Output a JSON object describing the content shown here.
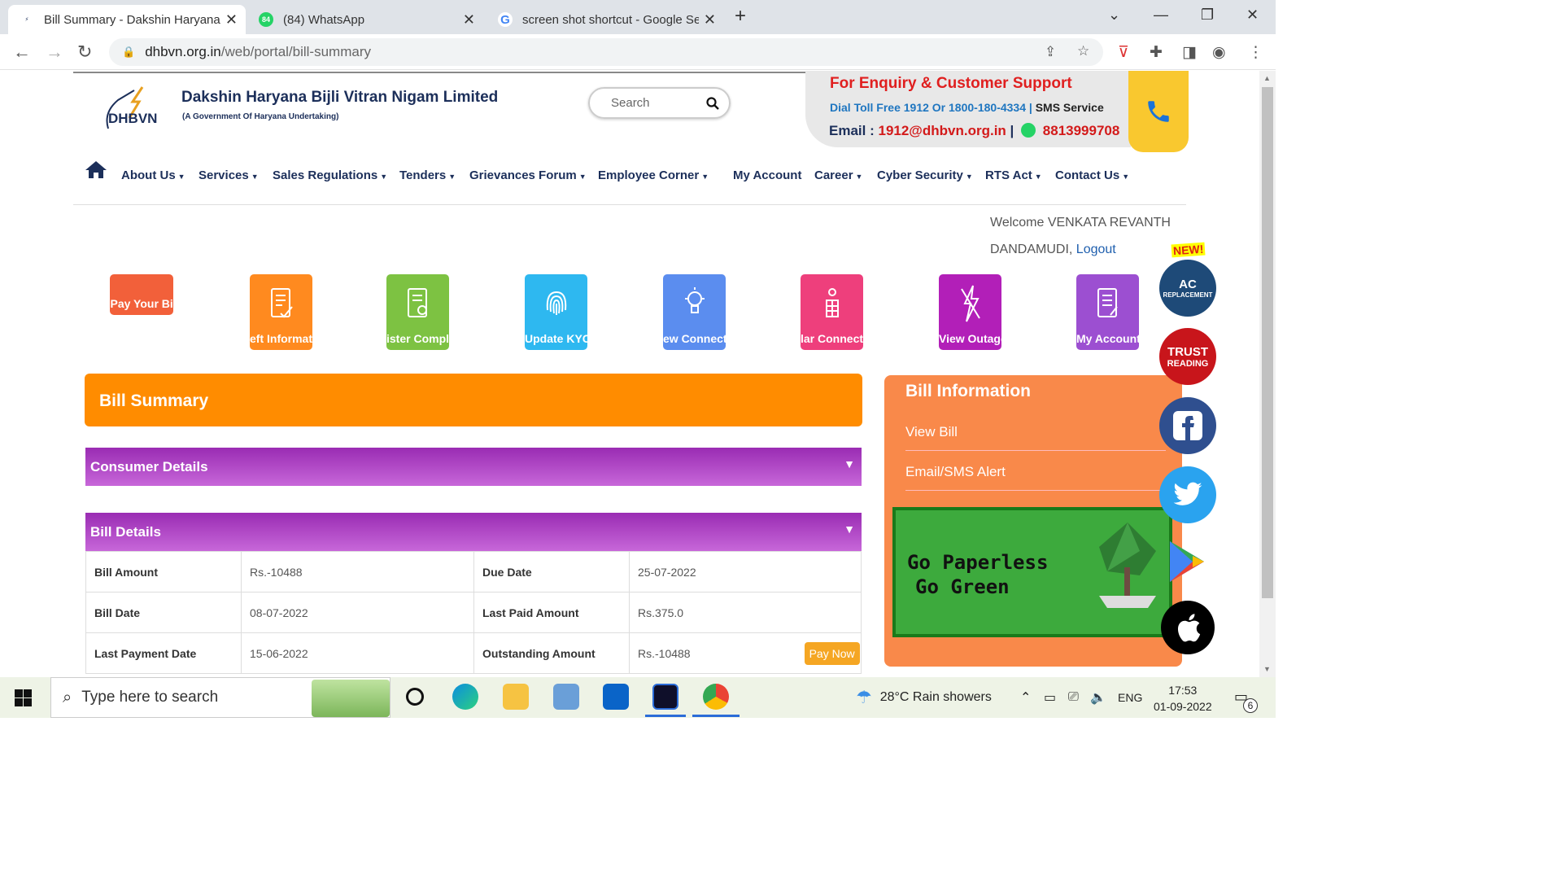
{
  "browser": {
    "tabs": [
      {
        "title": "Bill Summary - Dakshin Haryana B",
        "favicon": "dhbvn-favicon"
      },
      {
        "title": "(84) WhatsApp",
        "favicon": "whatsapp-favicon",
        "badge": "84"
      },
      {
        "title": "screen shot shortcut - Google Se",
        "favicon": "google-favicon"
      }
    ],
    "url_domain": "dhbvn.org.in",
    "url_path": "/web/portal/bill-summary"
  },
  "header": {
    "logo_text": "DHBVN",
    "org_name": "Dakshin Haryana Bijli Vitran Nigam Limited",
    "org_sub": "(A Government Of Haryana Undertaking)",
    "search_placeholder": "Search",
    "support_title": "For Enquiry & Customer Support",
    "support_dial": "Dial Toll Free 1912 Or 1800-180-4334 |",
    "support_sms": "SMS Service",
    "support_email_label": "Email :",
    "support_email": "1912@dhbvn.org.in",
    "support_sep": "|",
    "support_whatsapp": "8813999708"
  },
  "menu": [
    "About Us",
    "Services",
    "Sales Regulations",
    "Tenders",
    "Grievances Forum",
    "Employee Corner",
    "My Account",
    "Career",
    "Cyber Security",
    "RTS Act",
    "Contact Us"
  ],
  "welcome": {
    "text": "Welcome VENKATA REVANTH DANDAMUDI,",
    "logout": "Logout"
  },
  "quick_links": [
    {
      "label": "Pay Your Bill",
      "color": "#f2603a"
    },
    {
      "label": "eft Informat",
      "color": "#ff8a1f"
    },
    {
      "label": "ister Compla",
      "color": "#7dc242"
    },
    {
      "label": "Update KYC",
      "color": "#2eb8f0"
    },
    {
      "label": "ew Connecti",
      "color": "#5b8def"
    },
    {
      "label": "lar Connecti",
      "color": "#ee3f7c"
    },
    {
      "label": "View Outage",
      "color": "#b21fb8"
    },
    {
      "label": "My Account",
      "color": "#9c4fd1"
    }
  ],
  "bill_summary": {
    "title": "Bill Summary",
    "consumer_details": "Consumer Details",
    "bill_details": "Bill Details",
    "rows": [
      {
        "l1": "Bill Amount",
        "v1": "Rs.-10488",
        "l2": "Due Date",
        "v2": "25-07-2022"
      },
      {
        "l1": "Bill Date",
        "v1": "08-07-2022",
        "l2": "Last Paid Amount",
        "v2": "Rs.375.0"
      },
      {
        "l1": "Last Payment Date",
        "v1": "15-06-2022",
        "l2": "Outstanding Amount",
        "v2": "Rs.-10488"
      }
    ],
    "pay_now": "Pay Now"
  },
  "bill_info": {
    "title": "Bill Information",
    "links": [
      "View Bill",
      "Email/SMS Alert"
    ],
    "banner_line1": "Go Paperless",
    "banner_line2": "Go Green"
  },
  "badges": {
    "new": "NEW!",
    "ac_title": "AC",
    "ac_sub": "REPLACEMENT",
    "trust_title": "TRUST",
    "trust_sub": "READING"
  },
  "taskbar": {
    "search_placeholder": "Type here to search",
    "weather": "28°C  Rain showers",
    "lang": "ENG",
    "time": "17:53",
    "date": "01-09-2022",
    "notifications": "6"
  }
}
